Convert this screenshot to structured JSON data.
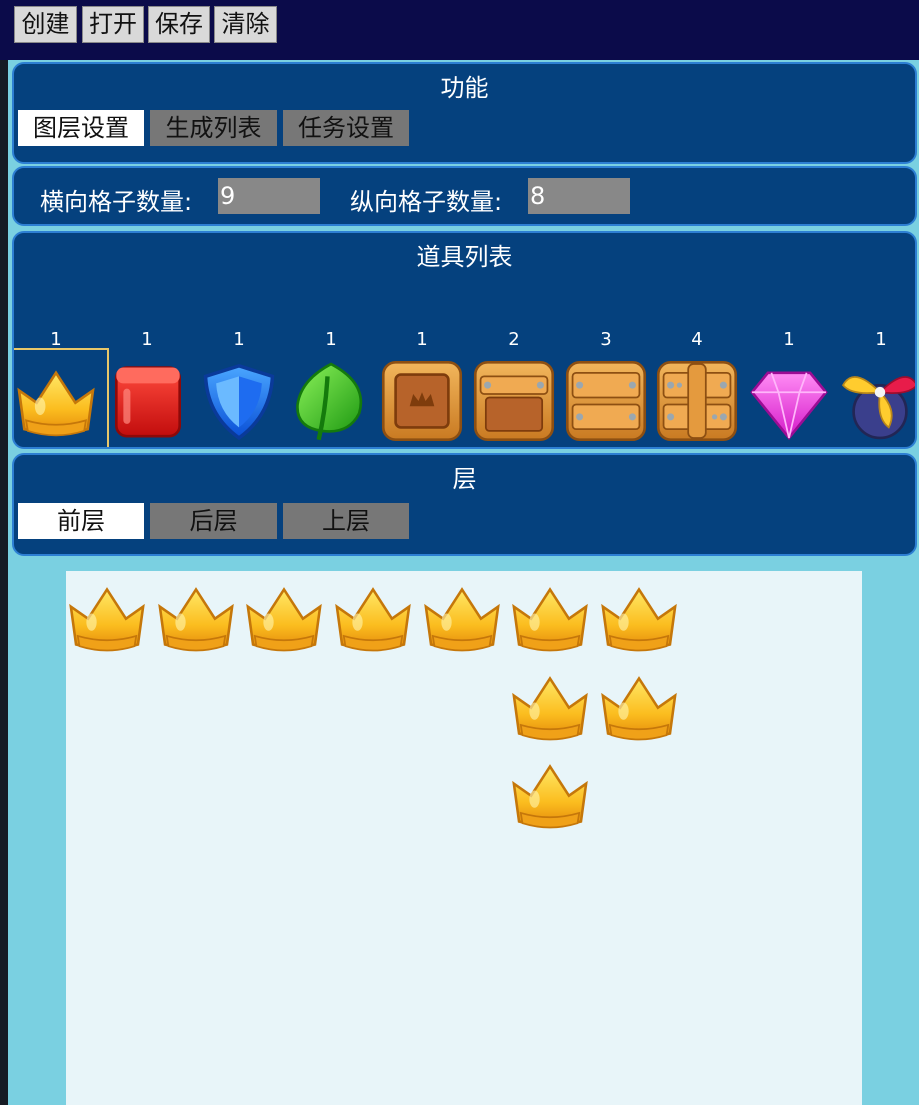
{
  "toolbar": {
    "create_label": "创建",
    "open_label": "打开",
    "save_label": "保存",
    "clear_label": "清除"
  },
  "function_panel": {
    "title": "功能",
    "tabs": [
      {
        "label": "图层设置",
        "active": true
      },
      {
        "label": "生成列表",
        "active": false
      },
      {
        "label": "任务设置",
        "active": false
      }
    ]
  },
  "grid_settings": {
    "horizontal_label": "横向格子数量:",
    "horizontal_value": "9",
    "vertical_label": "纵向格子数量:",
    "vertical_value": "8"
  },
  "item_list": {
    "title": "道具列表",
    "items": [
      {
        "icon": "crown-icon",
        "count": "1",
        "selected": true
      },
      {
        "icon": "red-cube-icon",
        "count": "1"
      },
      {
        "icon": "blue-shield-icon",
        "count": "1"
      },
      {
        "icon": "green-leaf-icon",
        "count": "1"
      },
      {
        "icon": "wooden-crown-box-icon",
        "count": "1"
      },
      {
        "icon": "wooden-crate-icon",
        "count": "2"
      },
      {
        "icon": "wooden-double-crate-icon",
        "count": "3"
      },
      {
        "icon": "wooden-reinforced-crate-icon",
        "count": "4"
      },
      {
        "icon": "pink-gem-icon",
        "count": "1"
      },
      {
        "icon": "propeller-bomb-icon",
        "count": "1"
      }
    ]
  },
  "layer_panel": {
    "title": "层",
    "tabs": [
      {
        "label": "前层",
        "active": true
      },
      {
        "label": "后层",
        "active": false
      },
      {
        "label": "上层",
        "active": false
      }
    ]
  },
  "board": {
    "columns": 9,
    "rows": 8,
    "placed_items": [
      {
        "icon": "crown-icon",
        "row": 1,
        "col": 1
      },
      {
        "icon": "crown-icon",
        "row": 1,
        "col": 2
      },
      {
        "icon": "crown-icon",
        "row": 1,
        "col": 3
      },
      {
        "icon": "crown-icon",
        "row": 1,
        "col": 4
      },
      {
        "icon": "crown-icon",
        "row": 1,
        "col": 5
      },
      {
        "icon": "crown-icon",
        "row": 1,
        "col": 6
      },
      {
        "icon": "crown-icon",
        "row": 1,
        "col": 7
      },
      {
        "icon": "crown-icon",
        "row": 2,
        "col": 6
      },
      {
        "icon": "crown-icon",
        "row": 2,
        "col": 7
      },
      {
        "icon": "crown-icon",
        "row": 3,
        "col": 6
      }
    ]
  },
  "colors": {
    "topbar": "#0b0b4a",
    "panel_bg": "#05417e",
    "panel_border": "#2d7fd3",
    "app_bg": "#7ad0e1",
    "board_bg": "#e8f5f9",
    "tab_inactive": "#777777",
    "input_bg": "#888888",
    "selection_border": "#e8c76a"
  }
}
